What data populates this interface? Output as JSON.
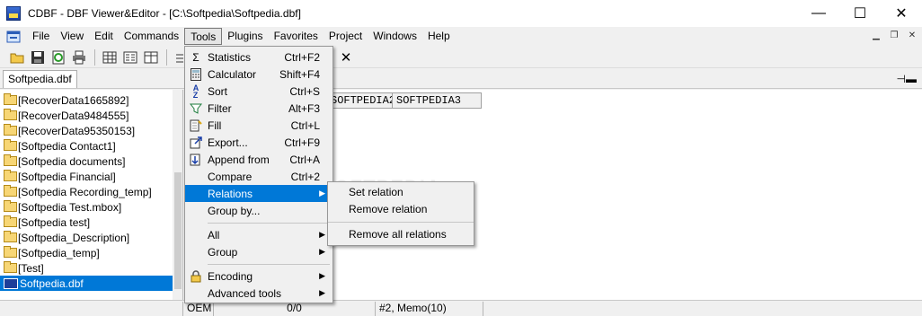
{
  "window": {
    "title": "CDBF - DBF Viewer&Editor - [C:\\Softpedia\\Softpedia.dbf]",
    "buttons": {
      "minimize": "—",
      "maximize": "☐",
      "close": "✕"
    }
  },
  "menubar": {
    "items": [
      "File",
      "View",
      "Edit",
      "Commands",
      "Tools",
      "Plugins",
      "Favorites",
      "Project",
      "Windows",
      "Help"
    ],
    "active": "Tools",
    "mdi_buttons": {
      "minimize": "▁",
      "restore": "❐",
      "close": "✕"
    }
  },
  "toolbar": {
    "icons": [
      "open-icon",
      "save-icon",
      "refresh-icon",
      "print-icon",
      "grid-icon",
      "form-icon",
      "table-icon",
      "field-icon",
      "sort-icon",
      "sum-icon",
      "filter-icon",
      "clear-filter-icon",
      "mail-icon",
      "home-icon",
      "close-icon"
    ]
  },
  "tab": {
    "label": "Softpedia.dbf"
  },
  "tree": {
    "items": [
      "[RecoverData1665892]",
      "[RecoverData9484555]",
      "[RecoverData95350153]",
      "[Softpedia Contact1]",
      "[Softpedia documents]",
      "[Softpedia Financial]",
      "[Softpedia Recording_temp]",
      "[Softpedia Test.mbox]",
      "[Softpedia test]",
      "[Softpedia_Description]",
      "[Softpedia_temp]",
      "[Test]"
    ],
    "selected": "Softpedia.dbf"
  },
  "grid": {
    "columns": [
      "SOFTPEDIA2",
      "SOFTPEDIA3"
    ]
  },
  "tools_menu": {
    "items": [
      {
        "label": "Statistics",
        "shortcut": "Ctrl+F2",
        "icon": "sigma-icon"
      },
      {
        "label": "Calculator",
        "shortcut": "Shift+F4",
        "icon": "calculator-icon"
      },
      {
        "label": "Sort",
        "shortcut": "Ctrl+S",
        "icon": "sort-az-icon"
      },
      {
        "label": "Filter",
        "shortcut": "Alt+F3",
        "icon": "funnel-icon"
      },
      {
        "label": "Fill",
        "shortcut": "Ctrl+L",
        "icon": "fill-icon"
      },
      {
        "label": "Export...",
        "shortcut": "Ctrl+F9",
        "icon": "export-icon"
      },
      {
        "label": "Append from",
        "shortcut": "Ctrl+A",
        "icon": "append-icon"
      },
      {
        "label": "Compare",
        "shortcut": "Ctrl+2",
        "icon": ""
      },
      {
        "label": "Relations",
        "shortcut": "",
        "icon": "",
        "submenu": true
      },
      {
        "label": "Group by...",
        "shortcut": "",
        "icon": ""
      },
      {
        "label": "All",
        "shortcut": "",
        "icon": "",
        "submenu": true
      },
      {
        "label": "Group",
        "shortcut": "",
        "icon": "",
        "submenu": true
      },
      {
        "label": "Encoding",
        "shortcut": "",
        "icon": "encoding-icon",
        "submenu": true
      },
      {
        "label": "Advanced tools",
        "shortcut": "",
        "icon": "",
        "submenu": true
      }
    ]
  },
  "relations_submenu": {
    "items": [
      "Set relation",
      "Remove relation",
      "Remove all relations"
    ]
  },
  "status": {
    "encoding": "OEM",
    "position": "0/0",
    "field": "#2, Memo(10)"
  },
  "watermark": "SOFTPEDIA",
  "colors": {
    "highlight": "#0078d7",
    "menu_bg": "#f0f0f0"
  }
}
